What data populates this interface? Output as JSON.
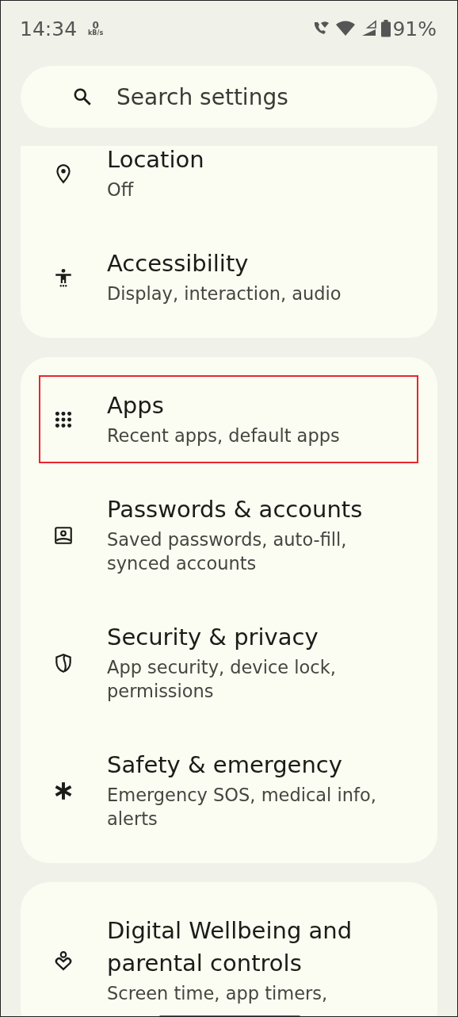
{
  "status_bar": {
    "time": "14:34",
    "net_speed_value": "0",
    "net_speed_unit": "kB/s",
    "battery": "91%"
  },
  "search": {
    "placeholder": "Search settings"
  },
  "groups": [
    {
      "items": [
        {
          "title_lines": [
            "Location"
          ],
          "subtitle_lines": [
            "Off"
          ],
          "highlighted": false
        },
        {
          "title_lines": [
            "Accessibility"
          ],
          "subtitle_lines": [
            "Display, interaction, audio"
          ],
          "highlighted": false
        }
      ]
    },
    {
      "items": [
        {
          "title_lines": [
            "Apps"
          ],
          "subtitle_lines": [
            "Recent apps, default apps"
          ],
          "highlighted": true
        },
        {
          "title_lines": [
            "Passwords & accounts"
          ],
          "subtitle_lines": [
            "Saved passwords, auto-fill,",
            "synced accounts"
          ],
          "highlighted": false
        },
        {
          "title_lines": [
            "Security & privacy"
          ],
          "subtitle_lines": [
            "App security, device lock,",
            "permissions"
          ],
          "highlighted": false
        },
        {
          "title_lines": [
            "Safety & emergency"
          ],
          "subtitle_lines": [
            "Emergency SOS, medical info,",
            "alerts"
          ],
          "highlighted": false
        }
      ]
    },
    {
      "items": [
        {
          "title_lines": [
            "Digital Wellbeing and",
            "parental controls"
          ],
          "subtitle_lines": [
            "Screen time, app timers,"
          ],
          "highlighted": false
        }
      ]
    }
  ]
}
